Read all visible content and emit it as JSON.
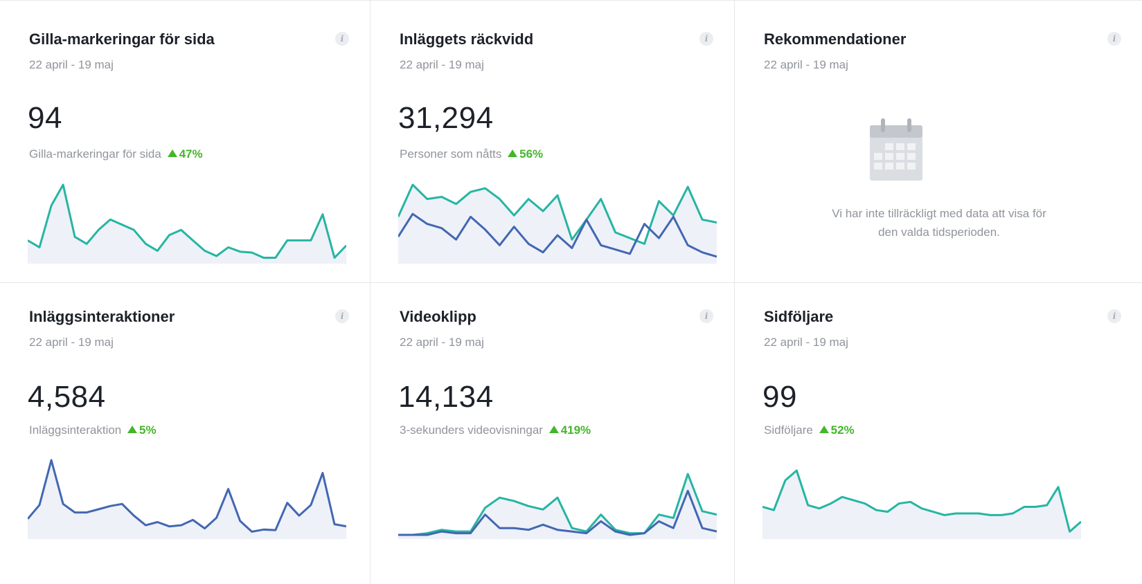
{
  "colors": {
    "teal": "#26b5a2",
    "blue": "#4267b2",
    "fill": "#eef1f8",
    "up": "#42b72a"
  },
  "cards": [
    {
      "title": "Gilla-markeringar för sida",
      "date": "22 april - 19 maj",
      "value": "94",
      "metric_label": "Gilla-markeringar för sida",
      "delta": "47%",
      "sparkline": {
        "series": [
          {
            "color": "teal",
            "values": [
              2.2,
              1.4,
              6.2,
              8.6,
              2.6,
              1.8,
              3.4,
              4.6,
              4.0,
              3.4,
              1.8,
              1.0,
              2.8,
              3.4,
              2.2,
              1.0,
              0.4,
              1.4,
              0.9,
              0.8,
              0.2,
              0.2,
              2.2,
              2.2,
              2.2,
              5.2,
              0.2,
              1.6
            ]
          }
        ]
      }
    },
    {
      "title": "Inläggets räckvidd",
      "date": "22 april - 19 maj",
      "value": "31,294",
      "metric_label": "Personer som nåtts",
      "delta": "56%",
      "sparkline": {
        "series": [
          {
            "color": "teal",
            "values": [
              6.0,
              10.5,
              8.5,
              8.8,
              7.8,
              9.5,
              10.0,
              8.5,
              6.2,
              8.5,
              6.8,
              9.0,
              2.8,
              5.6,
              8.5,
              3.8,
              3.0,
              2.2,
              8.2,
              6.2,
              10.2,
              5.6,
              5.2
            ]
          },
          {
            "color": "blue",
            "values": [
              3.2,
              6.4,
              5.0,
              4.4,
              2.8,
              6.0,
              4.2,
              2.0,
              4.6,
              2.2,
              1.0,
              3.4,
              1.6,
              5.6,
              2.0,
              1.4,
              0.8,
              5.0,
              3.0,
              6.0,
              2.0,
              1.0,
              0.4
            ]
          }
        ]
      }
    },
    {
      "title": "Rekommendationer",
      "date": "22 april - 19 maj",
      "empty": true,
      "empty_text_line1": "Vi har inte tillräckligt med data att visa för",
      "empty_text_line2": "den valda tidsperioden."
    },
    {
      "title": "Inläggsinteraktioner",
      "date": "22 april - 19 maj",
      "value": "4,584",
      "metric_label": "Inläggsinteraktion",
      "delta": "5%",
      "sparkline": {
        "series": [
          {
            "color": "blue",
            "values": [
              3.0,
              5.6,
              14.0,
              5.8,
              4.2,
              4.2,
              4.8,
              5.4,
              5.8,
              3.6,
              1.8,
              2.4,
              1.6,
              1.8,
              2.8,
              1.2,
              3.2,
              8.6,
              2.6,
              0.6,
              1.0,
              0.9,
              6.0,
              3.6,
              5.6,
              11.6,
              2.0,
              1.6
            ]
          }
        ]
      }
    },
    {
      "title": "Videoklipp",
      "date": "22 april - 19 maj",
      "value": "14,134",
      "metric_label": "3-sekunders videovisningar",
      "delta": "419%",
      "sparkline": {
        "series": [
          {
            "color": "teal",
            "values": [
              0.0,
              0.0,
              0.1,
              0.3,
              0.2,
              0.2,
              1.6,
              2.2,
              2.0,
              1.7,
              1.5,
              2.2,
              0.4,
              0.2,
              1.2,
              0.3,
              0.1,
              0.1,
              1.2,
              1.0,
              3.6,
              1.4,
              1.2
            ]
          },
          {
            "color": "blue",
            "values": [
              0.0,
              0.0,
              0.0,
              0.2,
              0.1,
              0.1,
              1.2,
              0.4,
              0.4,
              0.3,
              0.6,
              0.3,
              0.2,
              0.1,
              0.8,
              0.2,
              0.0,
              0.1,
              0.8,
              0.4,
              2.6,
              0.4,
              0.2
            ]
          }
        ]
      }
    },
    {
      "title": "Sidföljare",
      "date": "22 april - 19 maj",
      "value": "99",
      "metric_label": "Sidföljare",
      "delta": "52%",
      "sparkline": {
        "series": [
          {
            "color": "teal",
            "values": [
              3.4,
              3.0,
              6.6,
              7.8,
              3.6,
              3.2,
              3.8,
              4.6,
              4.2,
              3.8,
              3.0,
              2.8,
              3.8,
              4.0,
              3.2,
              2.8,
              2.4,
              2.6,
              2.6,
              2.6,
              2.4,
              2.4,
              2.6,
              3.4,
              3.4,
              3.6,
              5.8,
              0.4,
              1.6
            ]
          }
        ]
      }
    }
  ]
}
